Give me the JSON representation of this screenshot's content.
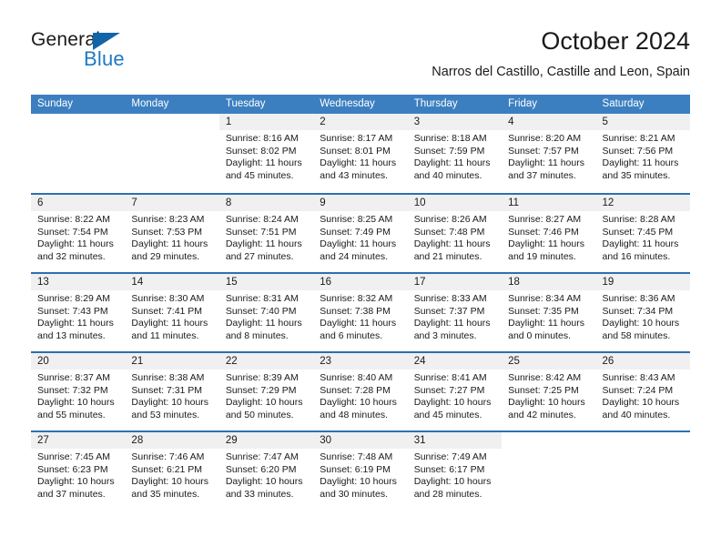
{
  "brand": {
    "word1": "General",
    "word2": "Blue",
    "triangle_color": "#1264a9",
    "blue_color": "#1e7ac4"
  },
  "header": {
    "title": "October 2024",
    "subtitle": "Narros del Castillo, Castille and Leon, Spain"
  },
  "theme": {
    "header_bar": "#3c7fc0",
    "week_divider": "#2f6fae",
    "day_strip": "#f0f0f0",
    "text": "#1a1a1a"
  },
  "weekdays": [
    "Sunday",
    "Monday",
    "Tuesday",
    "Wednesday",
    "Thursday",
    "Friday",
    "Saturday"
  ],
  "weeks": [
    {
      "days": [
        {
          "num": "",
          "lines": []
        },
        {
          "num": "",
          "lines": []
        },
        {
          "num": "1",
          "lines": [
            "Sunrise: 8:16 AM",
            "Sunset: 8:02 PM",
            "Daylight: 11 hours",
            "and 45 minutes."
          ]
        },
        {
          "num": "2",
          "lines": [
            "Sunrise: 8:17 AM",
            "Sunset: 8:01 PM",
            "Daylight: 11 hours",
            "and 43 minutes."
          ]
        },
        {
          "num": "3",
          "lines": [
            "Sunrise: 8:18 AM",
            "Sunset: 7:59 PM",
            "Daylight: 11 hours",
            "and 40 minutes."
          ]
        },
        {
          "num": "4",
          "lines": [
            "Sunrise: 8:20 AM",
            "Sunset: 7:57 PM",
            "Daylight: 11 hours",
            "and 37 minutes."
          ]
        },
        {
          "num": "5",
          "lines": [
            "Sunrise: 8:21 AM",
            "Sunset: 7:56 PM",
            "Daylight: 11 hours",
            "and 35 minutes."
          ]
        }
      ]
    },
    {
      "days": [
        {
          "num": "6",
          "lines": [
            "Sunrise: 8:22 AM",
            "Sunset: 7:54 PM",
            "Daylight: 11 hours",
            "and 32 minutes."
          ]
        },
        {
          "num": "7",
          "lines": [
            "Sunrise: 8:23 AM",
            "Sunset: 7:53 PM",
            "Daylight: 11 hours",
            "and 29 minutes."
          ]
        },
        {
          "num": "8",
          "lines": [
            "Sunrise: 8:24 AM",
            "Sunset: 7:51 PM",
            "Daylight: 11 hours",
            "and 27 minutes."
          ]
        },
        {
          "num": "9",
          "lines": [
            "Sunrise: 8:25 AM",
            "Sunset: 7:49 PM",
            "Daylight: 11 hours",
            "and 24 minutes."
          ]
        },
        {
          "num": "10",
          "lines": [
            "Sunrise: 8:26 AM",
            "Sunset: 7:48 PM",
            "Daylight: 11 hours",
            "and 21 minutes."
          ]
        },
        {
          "num": "11",
          "lines": [
            "Sunrise: 8:27 AM",
            "Sunset: 7:46 PM",
            "Daylight: 11 hours",
            "and 19 minutes."
          ]
        },
        {
          "num": "12",
          "lines": [
            "Sunrise: 8:28 AM",
            "Sunset: 7:45 PM",
            "Daylight: 11 hours",
            "and 16 minutes."
          ]
        }
      ]
    },
    {
      "days": [
        {
          "num": "13",
          "lines": [
            "Sunrise: 8:29 AM",
            "Sunset: 7:43 PM",
            "Daylight: 11 hours",
            "and 13 minutes."
          ]
        },
        {
          "num": "14",
          "lines": [
            "Sunrise: 8:30 AM",
            "Sunset: 7:41 PM",
            "Daylight: 11 hours",
            "and 11 minutes."
          ]
        },
        {
          "num": "15",
          "lines": [
            "Sunrise: 8:31 AM",
            "Sunset: 7:40 PM",
            "Daylight: 11 hours",
            "and 8 minutes."
          ]
        },
        {
          "num": "16",
          "lines": [
            "Sunrise: 8:32 AM",
            "Sunset: 7:38 PM",
            "Daylight: 11 hours",
            "and 6 minutes."
          ]
        },
        {
          "num": "17",
          "lines": [
            "Sunrise: 8:33 AM",
            "Sunset: 7:37 PM",
            "Daylight: 11 hours",
            "and 3 minutes."
          ]
        },
        {
          "num": "18",
          "lines": [
            "Sunrise: 8:34 AM",
            "Sunset: 7:35 PM",
            "Daylight: 11 hours",
            "and 0 minutes."
          ]
        },
        {
          "num": "19",
          "lines": [
            "Sunrise: 8:36 AM",
            "Sunset: 7:34 PM",
            "Daylight: 10 hours",
            "and 58 minutes."
          ]
        }
      ]
    },
    {
      "days": [
        {
          "num": "20",
          "lines": [
            "Sunrise: 8:37 AM",
            "Sunset: 7:32 PM",
            "Daylight: 10 hours",
            "and 55 minutes."
          ]
        },
        {
          "num": "21",
          "lines": [
            "Sunrise: 8:38 AM",
            "Sunset: 7:31 PM",
            "Daylight: 10 hours",
            "and 53 minutes."
          ]
        },
        {
          "num": "22",
          "lines": [
            "Sunrise: 8:39 AM",
            "Sunset: 7:29 PM",
            "Daylight: 10 hours",
            "and 50 minutes."
          ]
        },
        {
          "num": "23",
          "lines": [
            "Sunrise: 8:40 AM",
            "Sunset: 7:28 PM",
            "Daylight: 10 hours",
            "and 48 minutes."
          ]
        },
        {
          "num": "24",
          "lines": [
            "Sunrise: 8:41 AM",
            "Sunset: 7:27 PM",
            "Daylight: 10 hours",
            "and 45 minutes."
          ]
        },
        {
          "num": "25",
          "lines": [
            "Sunrise: 8:42 AM",
            "Sunset: 7:25 PM",
            "Daylight: 10 hours",
            "and 42 minutes."
          ]
        },
        {
          "num": "26",
          "lines": [
            "Sunrise: 8:43 AM",
            "Sunset: 7:24 PM",
            "Daylight: 10 hours",
            "and 40 minutes."
          ]
        }
      ]
    },
    {
      "days": [
        {
          "num": "27",
          "lines": [
            "Sunrise: 7:45 AM",
            "Sunset: 6:23 PM",
            "Daylight: 10 hours",
            "and 37 minutes."
          ]
        },
        {
          "num": "28",
          "lines": [
            "Sunrise: 7:46 AM",
            "Sunset: 6:21 PM",
            "Daylight: 10 hours",
            "and 35 minutes."
          ]
        },
        {
          "num": "29",
          "lines": [
            "Sunrise: 7:47 AM",
            "Sunset: 6:20 PM",
            "Daylight: 10 hours",
            "and 33 minutes."
          ]
        },
        {
          "num": "30",
          "lines": [
            "Sunrise: 7:48 AM",
            "Sunset: 6:19 PM",
            "Daylight: 10 hours",
            "and 30 minutes."
          ]
        },
        {
          "num": "31",
          "lines": [
            "Sunrise: 7:49 AM",
            "Sunset: 6:17 PM",
            "Daylight: 10 hours",
            "and 28 minutes."
          ]
        },
        {
          "num": "",
          "lines": []
        },
        {
          "num": "",
          "lines": []
        }
      ]
    }
  ]
}
